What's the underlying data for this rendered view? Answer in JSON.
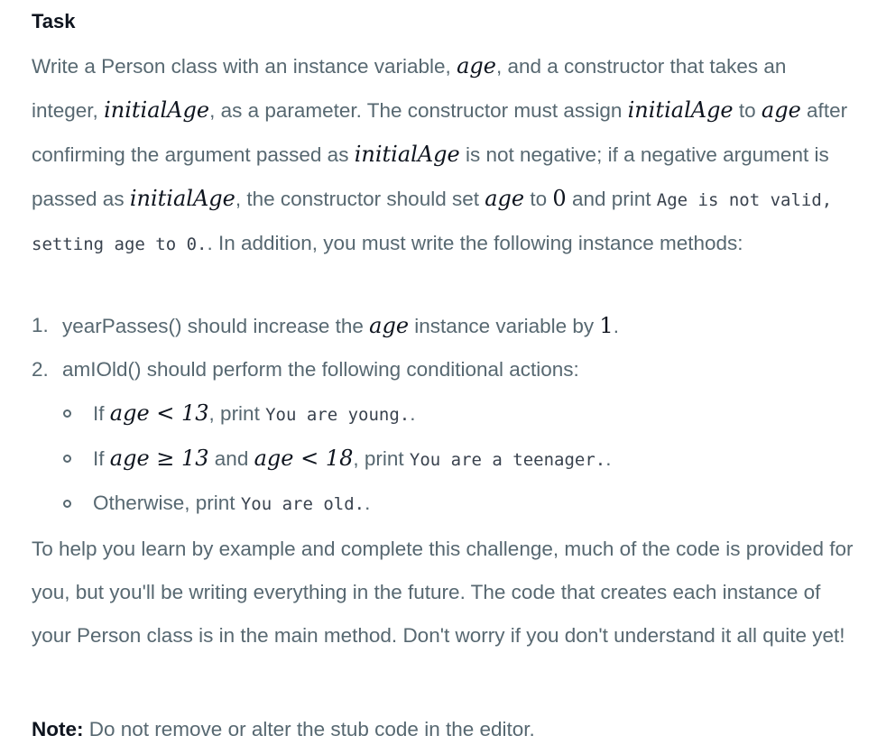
{
  "heading": "Task",
  "intro": {
    "t1": "Write a Person class with an instance variable, ",
    "age1": "age",
    "t2": ", and a constructor that takes an integer, ",
    "initialAge1": "initialAge",
    "t3": ", as a parameter. The constructor must assign ",
    "initialAge2": "initialAge",
    "t4": " to ",
    "age2": "age",
    "t5": " after confirming the argument passed as ",
    "initialAge3": "initialAge",
    "t6": " is not negative; if a negative argument is passed as ",
    "initialAge4": "initialAge",
    "t7": ", the constructor should set ",
    "age3": "age",
    "t8": " to ",
    "zero": "0",
    "t9": " and print ",
    "code_invalid": "Age is not valid, setting age to 0.",
    "t10": ". In addition, you must write the following instance methods:"
  },
  "methods": [
    {
      "marker": "1.",
      "t1": "yearPasses() should increase the ",
      "age": "age",
      "t2": " instance variable by ",
      "one": "1",
      "t3": "."
    },
    {
      "marker": "2.",
      "text": "amIOld() should perform the following conditional actions:",
      "conditions": [
        {
          "t1": "If ",
          "expr": "age < 13",
          "t2": ", print ",
          "code": "You are young.",
          "t3": "."
        },
        {
          "t1": "If ",
          "expr1": "age ≥ 13",
          "mid": " and ",
          "expr2": "age < 18",
          "t2": ", print ",
          "code": "You are a teenager.",
          "t3": "."
        },
        {
          "t1": "Otherwise, print ",
          "code": "You are old.",
          "t3": "."
        }
      ]
    }
  ],
  "help_paragraph": "To help you learn by example and complete this challenge, much of the code is provided for you, but you'll be writing everything in the future. The code that creates each instance of your Person class is in the main method. Don't worry if you don't understand it all quite yet!",
  "note": {
    "label": "Note:",
    "text": " Do not remove or alter the stub code in the editor."
  }
}
